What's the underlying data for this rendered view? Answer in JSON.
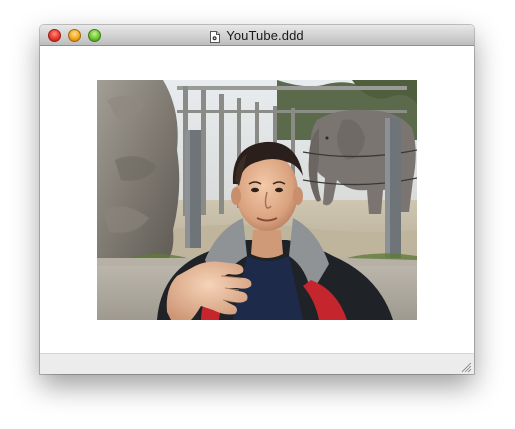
{
  "window": {
    "title": "YouTube.ddd",
    "title_icon": "document-icon",
    "controls": [
      "close",
      "minimize",
      "zoom"
    ]
  },
  "video": {
    "description_icon": "video-frame"
  },
  "colors": {
    "close": "#e8382c",
    "minimize": "#f3a81e",
    "zoom": "#6cc334",
    "statusbar": "#ececec"
  }
}
